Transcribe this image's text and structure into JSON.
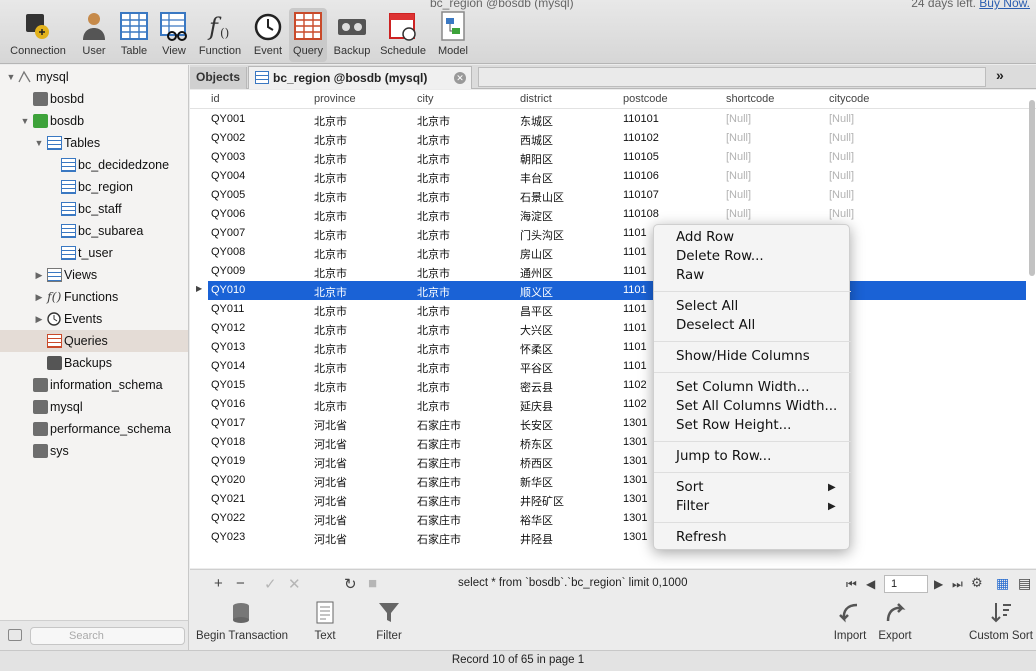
{
  "window": {
    "title_fragment": "bc_region @bosdb (mysql)",
    "trial_fragment": "24 days left.",
    "trial_link": "Buy Now."
  },
  "toolbar": {
    "buttons": [
      {
        "label": "Connection",
        "icon": "connection-icon"
      },
      {
        "label": "User",
        "icon": "user-icon"
      },
      {
        "label": "Table",
        "icon": "table-icon"
      },
      {
        "label": "View",
        "icon": "view-icon"
      },
      {
        "label": "Function",
        "icon": "function-icon"
      },
      {
        "label": "Event",
        "icon": "event-icon"
      },
      {
        "label": "Query",
        "icon": "query-icon",
        "active": true
      },
      {
        "label": "Backup",
        "icon": "backup-icon"
      },
      {
        "label": "Schedule",
        "icon": "schedule-icon"
      },
      {
        "label": "Model",
        "icon": "model-icon"
      }
    ]
  },
  "sidebar": {
    "items": [
      {
        "label": "mysql",
        "icon": "connection-icon"
      },
      {
        "label": "bosbd",
        "icon": "database-icon"
      },
      {
        "label": "bosdb",
        "icon": "database-icon"
      },
      {
        "label": "Tables",
        "icon": "tables-icon"
      },
      {
        "label": "bc_decidedzone",
        "icon": "table-icon"
      },
      {
        "label": "bc_region",
        "icon": "table-icon"
      },
      {
        "label": "bc_staff",
        "icon": "table-icon"
      },
      {
        "label": "bc_subarea",
        "icon": "table-icon"
      },
      {
        "label": "t_user",
        "icon": "table-icon"
      },
      {
        "label": "Views",
        "icon": "views-icon"
      },
      {
        "label": "Functions",
        "icon": "function-icon"
      },
      {
        "label": "Events",
        "icon": "event-icon"
      },
      {
        "label": "Queries",
        "icon": "query-icon"
      },
      {
        "label": "Backups",
        "icon": "backup-icon"
      },
      {
        "label": "information_schema",
        "icon": "database-icon"
      },
      {
        "label": "mysql",
        "icon": "database-icon"
      },
      {
        "label": "performance_schema",
        "icon": "database-icon"
      },
      {
        "label": "sys",
        "icon": "database-icon"
      }
    ],
    "search_placeholder": "Search"
  },
  "tabs": {
    "objects": "Objects",
    "active": "bc_region @bosdb (mysql)"
  },
  "grid": {
    "columns": [
      "id",
      "province",
      "city",
      "district",
      "postcode",
      "shortcode",
      "citycode"
    ],
    "null_text": "[Null]",
    "rows": [
      [
        "QY001",
        "北京市",
        "北京市",
        "东城区",
        "110101",
        "[Null]",
        "[Null]"
      ],
      [
        "QY002",
        "北京市",
        "北京市",
        "西城区",
        "110102",
        "[Null]",
        "[Null]"
      ],
      [
        "QY003",
        "北京市",
        "北京市",
        "朝阳区",
        "110105",
        "[Null]",
        "[Null]"
      ],
      [
        "QY004",
        "北京市",
        "北京市",
        "丰台区",
        "110106",
        "[Null]",
        "[Null]"
      ],
      [
        "QY005",
        "北京市",
        "北京市",
        "石景山区",
        "110107",
        "[Null]",
        "[Null]"
      ],
      [
        "QY006",
        "北京市",
        "北京市",
        "海淀区",
        "110108",
        "[Null]",
        "[Null]"
      ],
      [
        "QY007",
        "北京市",
        "北京市",
        "门头沟区",
        "1101",
        "",
        ""
      ],
      [
        "QY008",
        "北京市",
        "北京市",
        "房山区",
        "1101",
        "",
        ""
      ],
      [
        "QY009",
        "北京市",
        "北京市",
        "通州区",
        "1101",
        "",
        ""
      ],
      [
        "QY010",
        "北京市",
        "北京市",
        "顺义区",
        "1101",
        "",
        ""
      ],
      [
        "QY011",
        "北京市",
        "北京市",
        "昌平区",
        "1101",
        "",
        ""
      ],
      [
        "QY012",
        "北京市",
        "北京市",
        "大兴区",
        "1101",
        "",
        ""
      ],
      [
        "QY013",
        "北京市",
        "北京市",
        "怀柔区",
        "1101",
        "",
        ""
      ],
      [
        "QY014",
        "北京市",
        "北京市",
        "平谷区",
        "1101",
        "",
        ""
      ],
      [
        "QY015",
        "北京市",
        "北京市",
        "密云县",
        "1102",
        "",
        ""
      ],
      [
        "QY016",
        "北京市",
        "北京市",
        "延庆县",
        "1102",
        "",
        ""
      ],
      [
        "QY017",
        "河北省",
        "石家庄市",
        "长安区",
        "1301",
        "",
        ""
      ],
      [
        "QY018",
        "河北省",
        "石家庄市",
        "桥东区",
        "1301",
        "",
        ""
      ],
      [
        "QY019",
        "河北省",
        "石家庄市",
        "桥西区",
        "1301",
        "",
        ""
      ],
      [
        "QY020",
        "河北省",
        "石家庄市",
        "新华区",
        "1301",
        "",
        ""
      ],
      [
        "QY021",
        "河北省",
        "石家庄市",
        "井陉矿区",
        "1301",
        "",
        ""
      ],
      [
        "QY022",
        "河北省",
        "石家庄市",
        "裕华区",
        "1301",
        "",
        ""
      ],
      [
        "QY023",
        "河北省",
        "石家庄市",
        "井陉县",
        "1301",
        "",
        ""
      ]
    ],
    "selected_row": 9
  },
  "context_menu": {
    "items": [
      "Add Row",
      "Delete Row...",
      "Raw",
      "Select All",
      "Deselect All",
      "Show/Hide Columns",
      "Set Column Width...",
      "Set All Columns Width...",
      "Set Row Height...",
      "Jump to Row...",
      "Sort",
      "Filter",
      "Refresh"
    ]
  },
  "grid_bar": {
    "sql": "select * from `bosdb`.`bc_region` limit 0,1000",
    "page": "1"
  },
  "action_bar": {
    "begin_transaction": "Begin Transaction",
    "text": "Text",
    "filter": "Filter",
    "import": "Import",
    "export": "Export",
    "custom_sort": "Custom Sort"
  },
  "status": "Record 10 of 65 in page 1"
}
